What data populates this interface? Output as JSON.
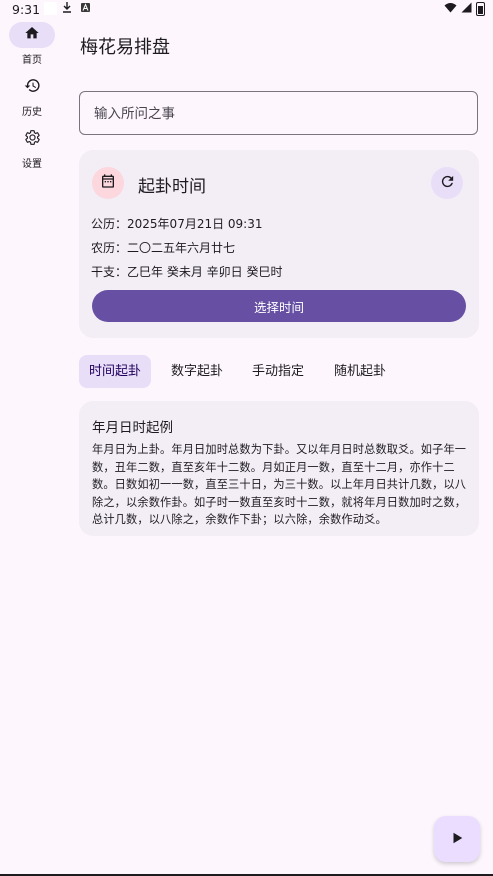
{
  "status_bar": {
    "time": "9:31"
  },
  "rail": {
    "items": [
      {
        "label": "首页",
        "icon": "home-icon",
        "active": true
      },
      {
        "label": "历史",
        "icon": "history-icon",
        "active": false
      },
      {
        "label": "设置",
        "icon": "gear-icon",
        "active": false
      }
    ]
  },
  "header": {
    "title": "梅花易排盘"
  },
  "question_input": {
    "placeholder": "输入所问之事",
    "value": ""
  },
  "time_card": {
    "title": "起卦时间",
    "solar_label": "公历：",
    "solar_value": "2025年07月21日 09:31",
    "lunar_label": "农历：",
    "lunar_value": "二〇二五年六月廿七",
    "ganzhi_label": "干支：",
    "ganzhi_value": "乙巳年 癸未月 辛卯日 癸巳时",
    "select_button": "选择时间"
  },
  "tabs": [
    {
      "label": "时间起卦",
      "active": true
    },
    {
      "label": "数字起卦",
      "active": false
    },
    {
      "label": "手动指定",
      "active": false
    },
    {
      "label": "随机起卦",
      "active": false
    }
  ],
  "info_card": {
    "title": "年月日时起例",
    "body": "年月日为上卦。年月日加时总数为下卦。又以年月日时总数取爻。如子年一数，丑年二数，直至亥年十二数。月如正月一数，直至十二月，亦作十二数。日数如初一一数，直至三十日，为三十数。以上年月日共计几数，以八除之，以余数作卦。如子时一数直至亥时十二数，就将年月日数加时之数，总计几数，以八除之，余数作下卦；以六除，余数作动爻。"
  },
  "colors": {
    "background": "#fdf6fd",
    "primary": "#6750a4",
    "secondary_container": "#e8def8",
    "surface_container": "#f3edf6",
    "calendar_badge": "#fcd7dd"
  }
}
